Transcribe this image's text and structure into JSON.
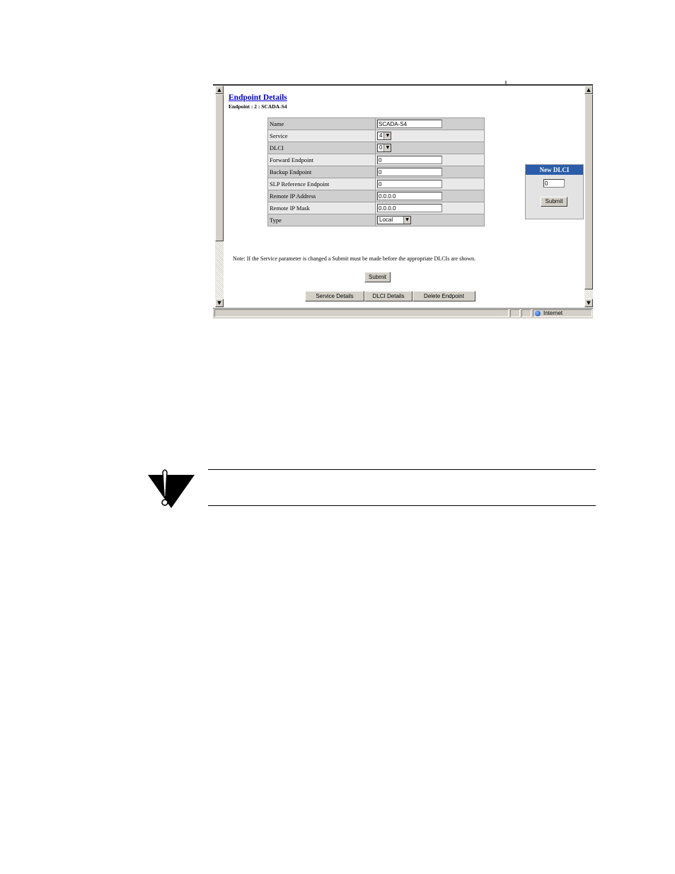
{
  "page": {
    "title": "Endpoint Details",
    "subtitle": "Endpoint : 2 : SCADA-S4"
  },
  "form": {
    "rows": [
      {
        "label": "Name",
        "kind": "text",
        "value": "SCADA-S4"
      },
      {
        "label": "Service",
        "kind": "select",
        "value": "4"
      },
      {
        "label": "DLCI",
        "kind": "select",
        "value": "0"
      },
      {
        "label": "Forward Endpoint",
        "kind": "text",
        "value": "0"
      },
      {
        "label": "Backup Endpoint",
        "kind": "text",
        "value": "0"
      },
      {
        "label": "SLP Reference Endpoint",
        "kind": "text",
        "value": "0"
      },
      {
        "label": "Remote IP Address",
        "kind": "text",
        "value": "0.0.0.0"
      },
      {
        "label": "Remote IP Mask",
        "kind": "text",
        "value": "0.0.0.0"
      },
      {
        "label": "Type",
        "kind": "select",
        "value": "Local"
      }
    ]
  },
  "note": "Note:  If the Service parameter is changed a Submit must be made before the appropriate DLCIs are shown.",
  "buttons": {
    "submit": "Submit",
    "service_details": "Service Details",
    "dlci_details": "DLCI Details",
    "delete_endpoint": "Delete Endpoint"
  },
  "new_dlci": {
    "title": "New DLCI",
    "value": "0",
    "submit": "Submit"
  },
  "status_bar": {
    "zone": "Internet"
  },
  "icons": {
    "scroll_up": "▲",
    "scroll_down": "▼",
    "dropdown": "▼"
  }
}
